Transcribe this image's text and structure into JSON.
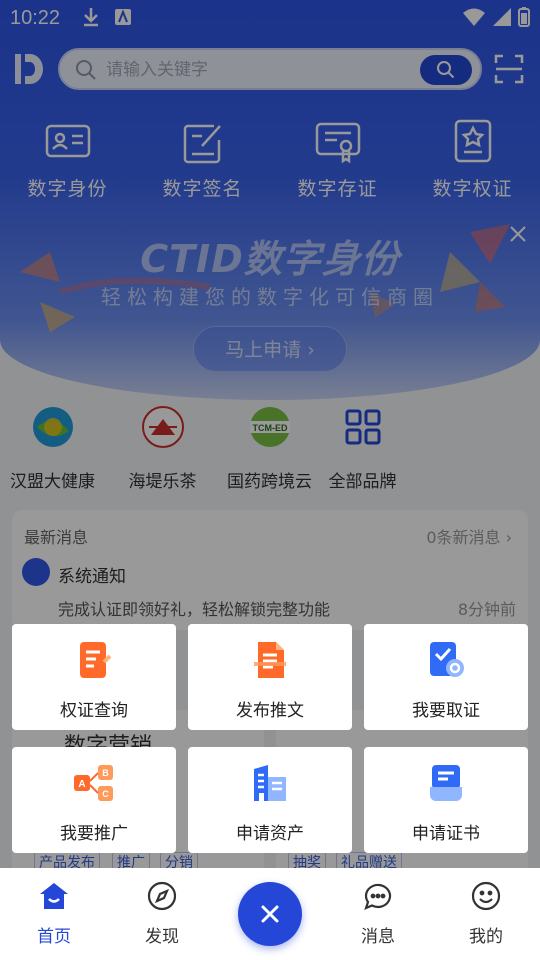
{
  "status_bar": {
    "time": "10:22"
  },
  "search": {
    "placeholder": "请输入关键字"
  },
  "features": [
    {
      "label": "数字身份",
      "icon": "id-card-icon"
    },
    {
      "label": "数字签名",
      "icon": "signature-icon"
    },
    {
      "label": "数字存证",
      "icon": "certificate-icon"
    },
    {
      "label": "数字权证",
      "icon": "warrant-icon"
    }
  ],
  "banner": {
    "title": "CTID数字身份",
    "subtitle": "轻松构建您的数字化可信商圈",
    "button": "马上申请 ›"
  },
  "brands": [
    {
      "label": "汉盟大健康",
      "icon": "hanmeng-logo"
    },
    {
      "label": "海堤乐茶",
      "icon": "haidi-logo"
    },
    {
      "label": "国药跨境云",
      "icon": "tcm-ed-logo",
      "logo_text": "TCM-ED"
    },
    {
      "label": "全部品牌",
      "icon": "grid-icon"
    }
  ],
  "messages": {
    "header": "最新消息",
    "count": "0条新消息 ›",
    "item_title": "系统通知",
    "item_body": "完成认证即领好礼，轻松解锁完整功能",
    "item_time": "8分钟前"
  },
  "background_partial": {
    "section_title": "数字营销",
    "chips_left": [
      "产品发布",
      "推广",
      "分销"
    ],
    "chips_right": [
      "抽奖",
      "礼品赠送"
    ]
  },
  "popup_menu": [
    {
      "label": "权证查询",
      "icon": "warrant-query-icon"
    },
    {
      "label": "发布推文",
      "icon": "publish-post-icon"
    },
    {
      "label": "我要取证",
      "icon": "get-evidence-icon"
    },
    {
      "label": "我要推广",
      "icon": "promote-icon"
    },
    {
      "label": "申请资产",
      "icon": "apply-asset-icon"
    },
    {
      "label": "申请证书",
      "icon": "apply-certificate-icon"
    }
  ],
  "bottom_nav": [
    {
      "label": "首页",
      "icon": "home-icon",
      "active": true
    },
    {
      "label": "发现",
      "icon": "compass-icon",
      "active": false
    },
    {
      "label": "消息",
      "icon": "chat-icon",
      "active": false
    },
    {
      "label": "我的",
      "icon": "smile-icon",
      "active": false
    }
  ],
  "colors": {
    "primary": "#2447d8",
    "orange": "#ff6a2a",
    "blue_icon": "#3b6cf6"
  }
}
